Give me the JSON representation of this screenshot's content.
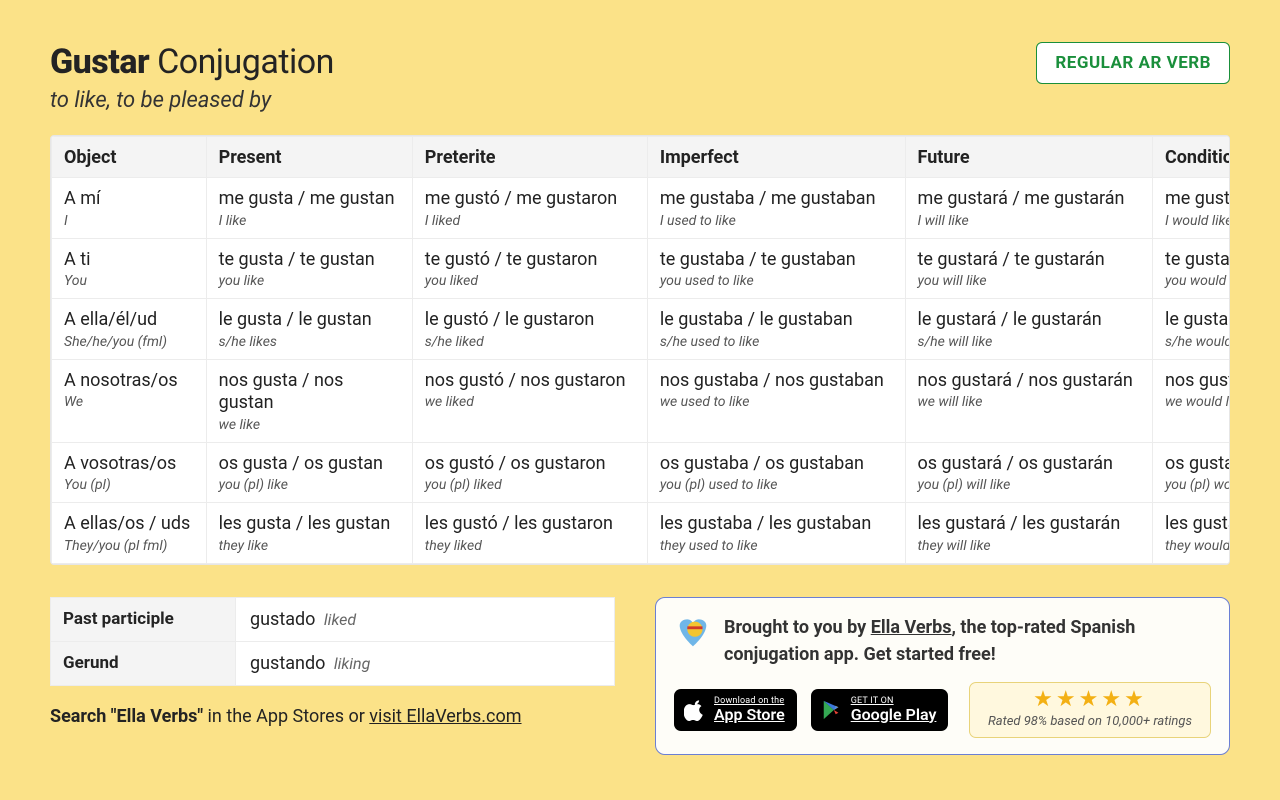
{
  "header": {
    "verb": "Gustar",
    "heading_rest": "Conjugation",
    "subtitle": "to like, to be pleased by",
    "badge": "REGULAR AR VERB"
  },
  "columns": [
    "Object",
    "Present",
    "Preterite",
    "Imperfect",
    "Future",
    "Conditional"
  ],
  "rows": [
    {
      "object": {
        "es": "A mí",
        "en": "I"
      },
      "cells": [
        {
          "es": "me gusta / me gustan",
          "en": "I like"
        },
        {
          "es": "me gustó / me gustaron",
          "en": "I liked"
        },
        {
          "es": "me gustaba / me gustaban",
          "en": "I used to like"
        },
        {
          "es": "me gustará / me gustarán",
          "en": "I will like"
        },
        {
          "es": "me gustaría / me gustarían",
          "en": "I would like"
        }
      ]
    },
    {
      "object": {
        "es": "A ti",
        "en": "You"
      },
      "cells": [
        {
          "es": "te gusta / te gustan",
          "en": "you like"
        },
        {
          "es": "te gustó / te gustaron",
          "en": "you liked"
        },
        {
          "es": "te gustaba / te gustaban",
          "en": "you used to like"
        },
        {
          "es": "te gustará / te gustarán",
          "en": "you will like"
        },
        {
          "es": "te gustaría / te gustarían",
          "en": "you would like"
        }
      ]
    },
    {
      "object": {
        "es": "A ella/él/ud",
        "en": "She/he/you (fml)"
      },
      "cells": [
        {
          "es": "le gusta / le gustan",
          "en": "s/he likes"
        },
        {
          "es": "le gustó / le gustaron",
          "en": "s/he liked"
        },
        {
          "es": "le gustaba / le gustaban",
          "en": "s/he used to like"
        },
        {
          "es": "le gustará / le gustarán",
          "en": "s/he will like"
        },
        {
          "es": "le gustaría / le gustarían",
          "en": "s/he would like"
        }
      ]
    },
    {
      "object": {
        "es": "A nosotras/os",
        "en": "We"
      },
      "cells": [
        {
          "es": "nos gusta / nos gustan",
          "en": "we like"
        },
        {
          "es": "nos gustó / nos gustaron",
          "en": "we liked"
        },
        {
          "es": "nos gustaba / nos gustaban",
          "en": "we used to like"
        },
        {
          "es": "nos gustará / nos gustarán",
          "en": "we will like"
        },
        {
          "es": "nos gustaría / nos gustarían",
          "en": "we would like"
        }
      ]
    },
    {
      "object": {
        "es": "A vosotras/os",
        "en": "You (pl)"
      },
      "cells": [
        {
          "es": "os gusta / os gustan",
          "en": "you (pl) like"
        },
        {
          "es": "os gustó / os gustaron",
          "en": "you (pl) liked"
        },
        {
          "es": "os gustaba / os gustaban",
          "en": "you (pl) used to like"
        },
        {
          "es": "os gustará / os gustarán",
          "en": "you (pl) will like"
        },
        {
          "es": "os gustaría / os gustarían",
          "en": "you (pl) would like"
        }
      ]
    },
    {
      "object": {
        "es": "A ellas/os / uds",
        "en": "They/you (pl fml)"
      },
      "cells": [
        {
          "es": "les gusta / les gustan",
          "en": "they like"
        },
        {
          "es": "les gustó / les gustaron",
          "en": "they liked"
        },
        {
          "es": "les gustaba / les gustaban",
          "en": "they used to like"
        },
        {
          "es": "les gustará / les gustarán",
          "en": "they will like"
        },
        {
          "es": "les gustaría / les gustarían",
          "en": "they would like"
        }
      ]
    }
  ],
  "forms": {
    "past_participle_label": "Past participle",
    "past_participle_es": "gustado",
    "past_participle_en": "liked",
    "gerund_label": "Gerund",
    "gerund_es": "gustando",
    "gerund_en": "liking"
  },
  "search_blurb": {
    "prefix": "Search ",
    "bold": "\"Ella Verbs\"",
    "mid": " in the App Stores or ",
    "link": "visit EllaVerbs.com"
  },
  "promo": {
    "line_prefix": "Brought to you by ",
    "link": "Ella Verbs",
    "line_suffix": ", the top-rated Spanish conjugation app. Get started free!",
    "appstore_l1": "Download on the",
    "appstore_l2": "App Store",
    "play_l1": "GET IT ON",
    "play_l2": "Google Play",
    "stars": "★★★★★",
    "rating_sub": "Rated 98% based on 10,000+ ratings"
  }
}
